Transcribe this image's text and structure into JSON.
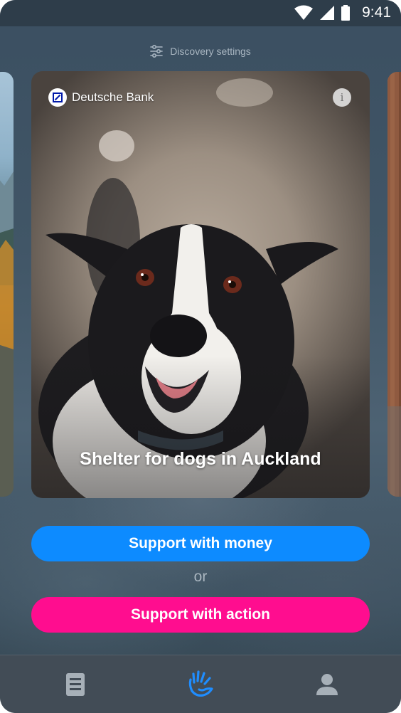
{
  "status_bar": {
    "time": "9:41"
  },
  "discovery": {
    "label": "Discovery settings",
    "icon": "sliders-icon"
  },
  "card": {
    "brand": "Deutsche Bank",
    "title": "Shelter for dogs in Auckland",
    "info_symbol": "i"
  },
  "actions": {
    "money_label": "Support with money",
    "or_label": "or",
    "action_label": "Support with action"
  },
  "colors": {
    "money": "#0d8bff",
    "action": "#ff0d8f",
    "nav_active": "#1f8dff",
    "nav_inactive": "#a7b0b8"
  },
  "bottom_nav": [
    {
      "name": "feed",
      "icon": "document-icon",
      "active": false
    },
    {
      "name": "discover",
      "icon": "hand-icon",
      "active": true
    },
    {
      "name": "profile",
      "icon": "person-icon",
      "active": false
    }
  ]
}
